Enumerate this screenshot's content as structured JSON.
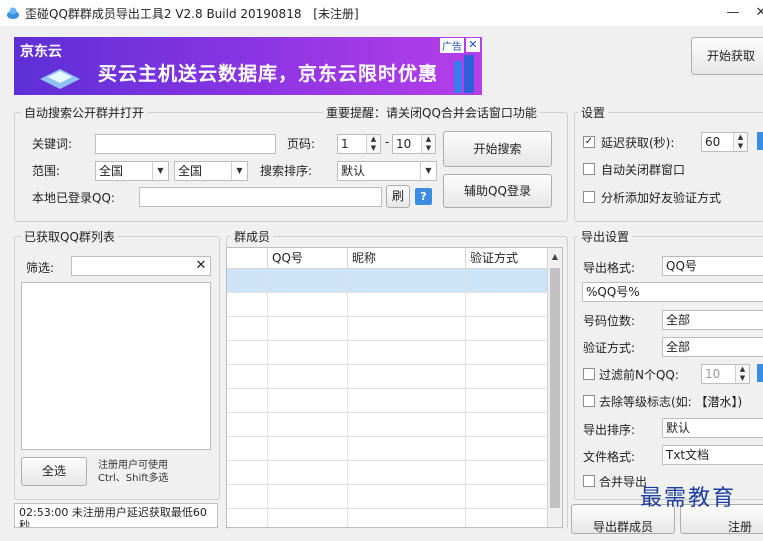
{
  "window": {
    "title": "歪碰QQ群群成员导出工具2 V2.8 Build 20190818",
    "status": "[未注册]",
    "minimize": "—",
    "close": "✕"
  },
  "banner": {
    "logo": "京东云",
    "slogan": "买云主机送云数据库，京东云限时优惠",
    "ad_label": "广告",
    "close": "✕"
  },
  "top_right": {
    "start_fetch": "开始获取"
  },
  "search": {
    "legend": "自动搜索公开群并打开",
    "notice": "重要提醒：请关闭QQ合并会话窗口功能",
    "keyword_label": "关键词:",
    "keyword_value": "",
    "page_label": "页码:",
    "page_from": "1",
    "page_sep": "-",
    "page_to": "10",
    "range_label": "范围:",
    "range_1": "全国",
    "range_2": "全国",
    "sort_label": "搜索排序:",
    "sort_value": "默认",
    "local_qq_label": "本地已登录QQ:",
    "local_qq_value": "",
    "refresh": "刷",
    "help": "?",
    "start_search": "开始搜索",
    "assist_login": "辅助QQ登录"
  },
  "settings": {
    "legend": "设置",
    "delay_label": "延迟获取(秒):",
    "delay_checked": true,
    "delay_value": "60",
    "auto_close_label": "自动关闭群窗口",
    "analyze_label": "分析添加好友验证方式"
  },
  "group_list": {
    "legend": "已获取QQ群列表",
    "filter_label": "筛选:",
    "filter_value": "",
    "clear": "✕",
    "select_all": "全选",
    "hint_1": "注册用户可使用",
    "hint_2": "Ctrl、Shift多选",
    "log": "02:53:00 未注册用户延迟获取最低60秒"
  },
  "members": {
    "legend": "群成员",
    "columns": [
      "QQ号",
      "昵称",
      "验证方式"
    ]
  },
  "export": {
    "legend": "导出设置",
    "format_label": "导出格式:",
    "format_value": "QQ号",
    "template": "%QQ号%",
    "digits_label": "号码位数:",
    "digits_value": "全部",
    "verify_label": "验证方式:",
    "verify_value": "全部",
    "filter_n_label": "过滤前N个QQ:",
    "filter_n_value": "10",
    "strip_label": "去除等级标志(如: 【潜水】)",
    "sort_label": "导出排序:",
    "sort_value": "默认",
    "file_label": "文件格式:",
    "file_value": "Txt文档",
    "merge_label": "合并导出",
    "export_btn": "导出群成员",
    "register_btn": "注册"
  },
  "watermark": "最需教育"
}
